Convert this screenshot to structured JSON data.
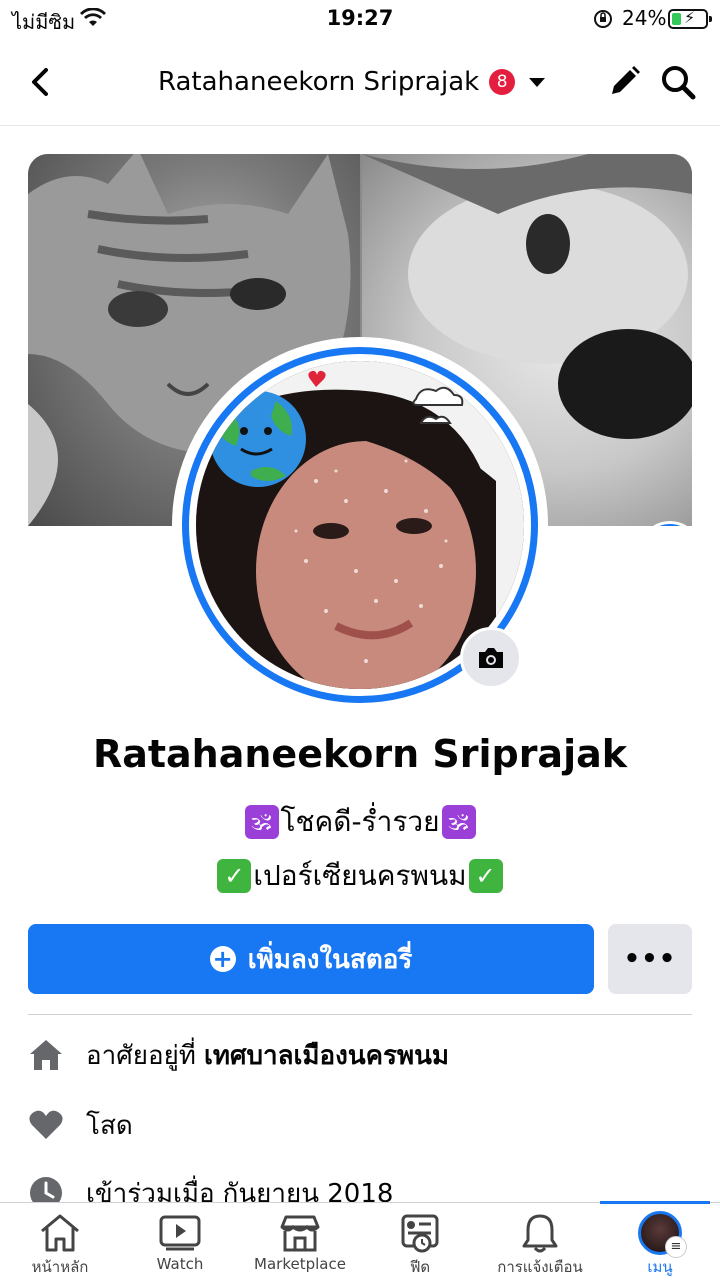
{
  "status_bar": {
    "carrier": "ไม่มีซิม",
    "time": "19:27",
    "battery": "24%"
  },
  "header": {
    "title": "Ratahaneekorn Sriprajak",
    "badge_count": "8"
  },
  "profile": {
    "name": "Ratahaneekorn Sriprajak",
    "bio_line1": "โชคดี-ร่ำรวย",
    "bio_line2": "เปอร์เซียนครพนม",
    "bio_line1_emoji": "🕉",
    "bio_line2_emoji": "✓"
  },
  "actions": {
    "add_story": "เพิ่มลงในสตอรี่",
    "more": "•••"
  },
  "details": [
    {
      "prefix": "อาศัยอยู่ที่",
      "value": "เทศบาลเมืองนครพนม"
    },
    {
      "prefix": "โสด",
      "value": ""
    },
    {
      "prefix": "เข้าร่วมเมื่อ",
      "value": "กันยายน 2018"
    }
  ],
  "bottom_nav": [
    {
      "label": "หน้าหลัก"
    },
    {
      "label": "Watch"
    },
    {
      "label": "Marketplace"
    },
    {
      "label": "ฟีด"
    },
    {
      "label": "การแจ้งเตือน"
    },
    {
      "label": "เมนู"
    }
  ],
  "colors": {
    "accent": "#1877f2",
    "badge": "#e41e3f",
    "button_secondary": "#e4e6eb"
  },
  "icons": {
    "back": "chevron-left-icon",
    "edit": "pencil-icon",
    "search": "search-icon",
    "avatar_creator": "avatar-icon",
    "camera": "camera-icon",
    "home": "home-icon",
    "watch": "play-icon",
    "marketplace": "store-icon",
    "feed": "feed-icon",
    "notifications": "bell-icon",
    "menu": "profile-menu-icon"
  }
}
